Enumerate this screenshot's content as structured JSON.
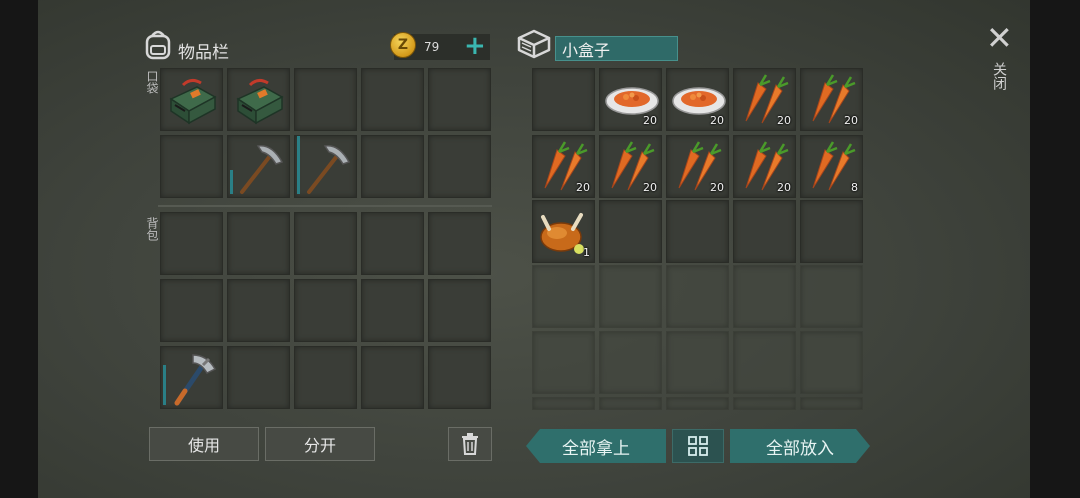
{
  "inventory": {
    "title": "物品栏",
    "coins": "79",
    "coin_symbol": "Z",
    "pocket_label": "口袋",
    "backpack_label": "背包",
    "slots_row1": [
      "ammo-box",
      "ammo-box",
      "",
      "",
      ""
    ],
    "slots_row2": [
      "",
      "pickaxe",
      "pickaxe",
      "",
      ""
    ],
    "backpack_row1": [
      "",
      "",
      "",
      "",
      ""
    ],
    "backpack_row2": [
      "",
      "",
      "",
      "",
      ""
    ],
    "backpack_row3": [
      "hatchet",
      "",
      "",
      "",
      ""
    ]
  },
  "container": {
    "name": "小盒子",
    "items": [
      {
        "icon": "",
        "qty": ""
      },
      {
        "icon": "carrot-salad-plate",
        "qty": "20"
      },
      {
        "icon": "carrot-salad-plate",
        "qty": "20"
      },
      {
        "icon": "carrot",
        "qty": "20"
      },
      {
        "icon": "carrot",
        "qty": "20"
      },
      {
        "icon": "carrot",
        "qty": "20"
      },
      {
        "icon": "carrot",
        "qty": "20"
      },
      {
        "icon": "carrot",
        "qty": "20"
      },
      {
        "icon": "carrot",
        "qty": "20"
      },
      {
        "icon": "carrot",
        "qty": "8"
      },
      {
        "icon": "roast-chicken",
        "qty": "1"
      },
      {
        "icon": "",
        "qty": ""
      },
      {
        "icon": "",
        "qty": ""
      },
      {
        "icon": "",
        "qty": ""
      },
      {
        "icon": "",
        "qty": ""
      }
    ]
  },
  "buttons": {
    "use": "使用",
    "split": "分开",
    "take_all": "全部拿上",
    "put_all": "全部放入"
  },
  "close": {
    "symbol": "✕",
    "label": "关闭"
  },
  "colors": {
    "accent": "#2f6f6c",
    "panel": "#3f433c",
    "durability": "#2a7f86"
  }
}
